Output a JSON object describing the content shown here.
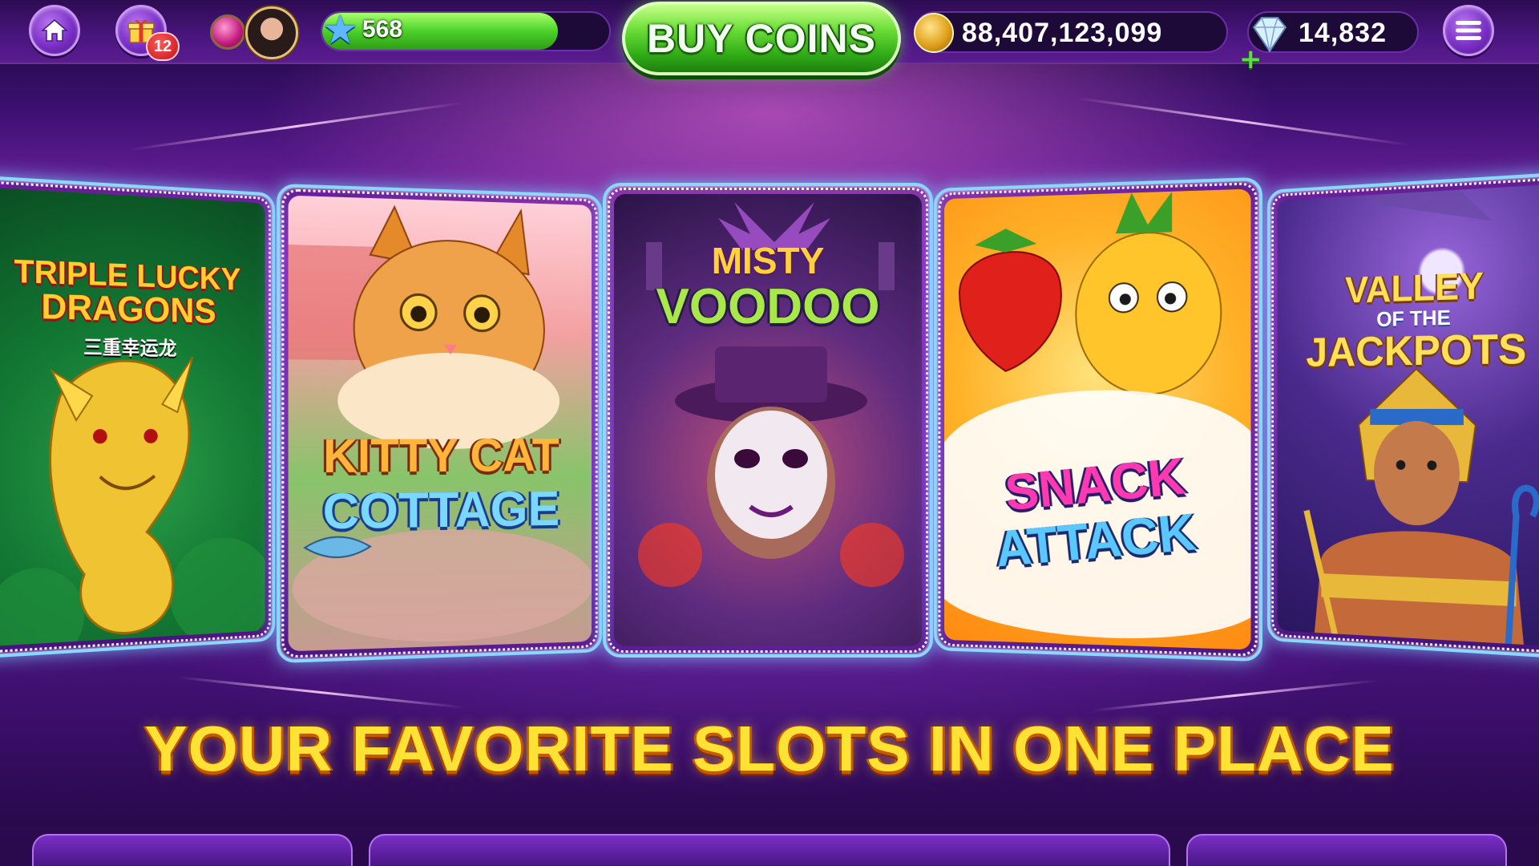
{
  "header": {
    "gift_badge": "12",
    "level": "568",
    "buy_coins_label": "BUY COINS",
    "coins": "88,407,123,099",
    "gems": "14,832",
    "xp_progress": 0.82
  },
  "icons": {
    "home": "home-icon",
    "gift": "gift-icon",
    "menu": "hamburger-menu-icon",
    "star": "star-icon",
    "coin": "coin-icon",
    "diamond": "diamond-icon"
  },
  "games": [
    {
      "line1": "TRIPLE LUCKY",
      "line2": "DRAGONS",
      "subtitle": "三重幸运龙"
    },
    {
      "line1": "KITTY CAT",
      "line2": "COTTAGE"
    },
    {
      "line1": "MISTY",
      "line2": "VOODOO"
    },
    {
      "line1": "SNACK",
      "line2": "ATTACK"
    },
    {
      "line1": "VALLEY",
      "line_mid": "OF THE",
      "line2": "JACKPOTS"
    }
  ],
  "tagline": "YOUR FAVORITE SLOTS IN ONE PLACE",
  "colors": {
    "accent_green": "#4bd12a",
    "title_yellow": "#ffe234",
    "card_glow": "#8ad8ff",
    "purple_bg": "#6a1f9c"
  }
}
